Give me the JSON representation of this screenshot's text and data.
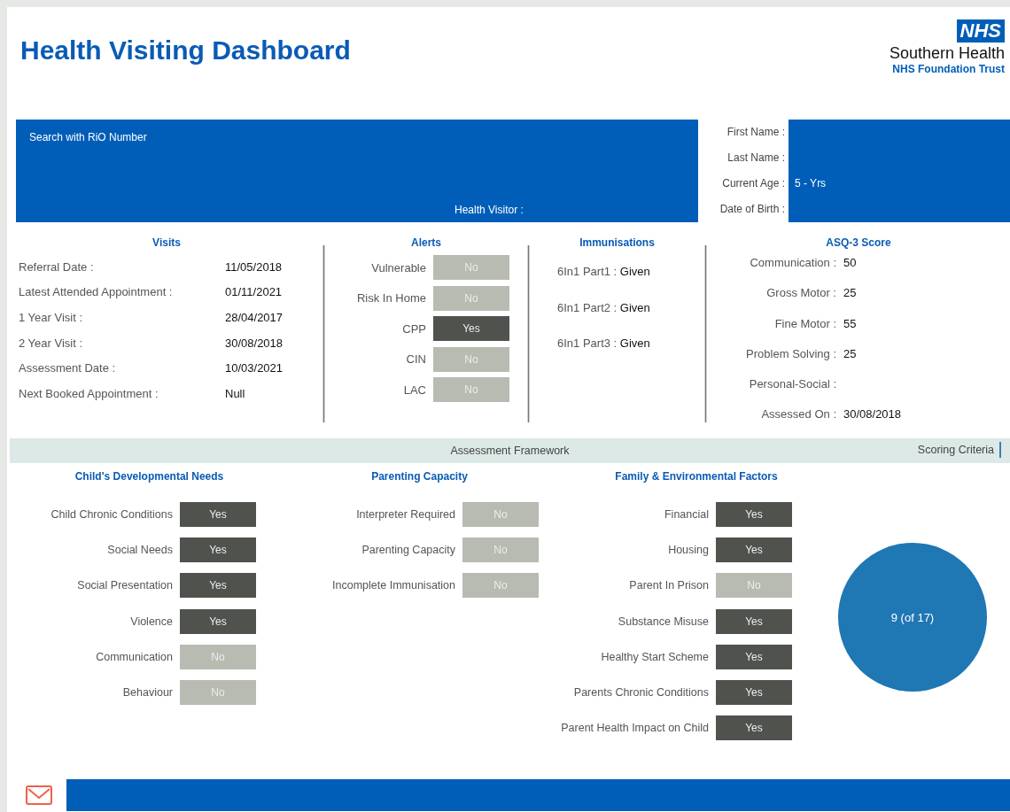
{
  "header": {
    "title": "Health Visiting Dashboard",
    "logo": {
      "badge": "NHS",
      "name": "Southern Health",
      "subtitle": "NHS Foundation Trust"
    }
  },
  "search": {
    "label": "Search with RiO Number",
    "health_visitor_label": "Health Visitor :"
  },
  "patient": [
    {
      "label": "First Name :"
    },
    {
      "label": "Last Name :"
    },
    {
      "label": "Current Age :",
      "value": "5 - Yrs"
    },
    {
      "label": "Date of Birth :"
    }
  ],
  "visits": {
    "title": "Visits",
    "rows": [
      {
        "label": "Referral Date :",
        "value": "11/05/2018"
      },
      {
        "label": "Latest Attended Appointment :",
        "value": "01/11/2021"
      },
      {
        "label": "1 Year Visit :",
        "value": "28/04/2017"
      },
      {
        "label": "2 Year Visit :",
        "value": "30/08/2018"
      },
      {
        "label": "Assessment Date :",
        "value": "10/03/2021"
      },
      {
        "label": "Next Booked Appointment :",
        "value": "Null"
      }
    ]
  },
  "alerts": {
    "title": "Alerts",
    "items": [
      {
        "label": "Vulnerable",
        "value": "No",
        "on": false
      },
      {
        "label": "Risk In Home",
        "value": "No",
        "on": false
      },
      {
        "label": "CPP",
        "value": "Yes",
        "on": true
      },
      {
        "label": "CIN",
        "value": "No",
        "on": false
      },
      {
        "label": "LAC",
        "value": "No",
        "on": false
      }
    ]
  },
  "immunisations": {
    "title": "Immunisations",
    "items": [
      {
        "label": "6In1 Part1 :",
        "value": "Given"
      },
      {
        "label": "6In1 Part2 :",
        "value": "Given"
      },
      {
        "label": "6In1 Part3 :",
        "value": "Given"
      }
    ]
  },
  "asq3": {
    "title": "ASQ-3 Score",
    "items": [
      {
        "label": "Communication :",
        "value": "50"
      },
      {
        "label": "Gross Motor :",
        "value": "25"
      },
      {
        "label": "Fine Motor :",
        "value": "55"
      },
      {
        "label": "Problem Solving :",
        "value": "25"
      },
      {
        "label": "Personal-Social :"
      },
      {
        "label": "Assessed On :",
        "value": "30/08/2018"
      }
    ]
  },
  "assessment_framework": {
    "title": "Assessment Framework",
    "scoring_link": "Scoring Criteria",
    "groups": [
      {
        "title": "Child's Developmental Needs",
        "items": [
          {
            "label": "Child Chronic Conditions",
            "value": "Yes",
            "on": true
          },
          {
            "label": "Social Needs",
            "value": "Yes",
            "on": true
          },
          {
            "label": "Social Presentation",
            "value": "Yes",
            "on": true
          },
          {
            "label": "Violence",
            "value": "Yes",
            "on": true
          },
          {
            "label": "Communication",
            "value": "No",
            "on": false
          },
          {
            "label": "Behaviour",
            "value": "No",
            "on": false
          }
        ]
      },
      {
        "title": "Parenting Capacity",
        "items": [
          {
            "label": "Interpreter Required",
            "value": "No",
            "on": false
          },
          {
            "label": "Parenting Capacity",
            "value": "No",
            "on": false
          },
          {
            "label": "Incomplete Immunisation",
            "value": "No",
            "on": false
          }
        ]
      },
      {
        "title": "Family & Environmental Factors",
        "items": [
          {
            "label": "Financial",
            "value": "Yes",
            "on": true
          },
          {
            "label": "Housing",
            "value": "Yes",
            "on": true
          },
          {
            "label": "Parent In Prison",
            "value": "No",
            "on": false
          },
          {
            "label": "Substance Misuse",
            "value": "Yes",
            "on": true
          },
          {
            "label": "Healthy Start Scheme",
            "value": "Yes",
            "on": true
          },
          {
            "label": "Parents Chronic Conditions",
            "value": "Yes",
            "on": true
          },
          {
            "label": "Parent Health Impact on Child",
            "value": "Yes",
            "on": true
          }
        ]
      }
    ],
    "total": "9 (of 17)"
  }
}
